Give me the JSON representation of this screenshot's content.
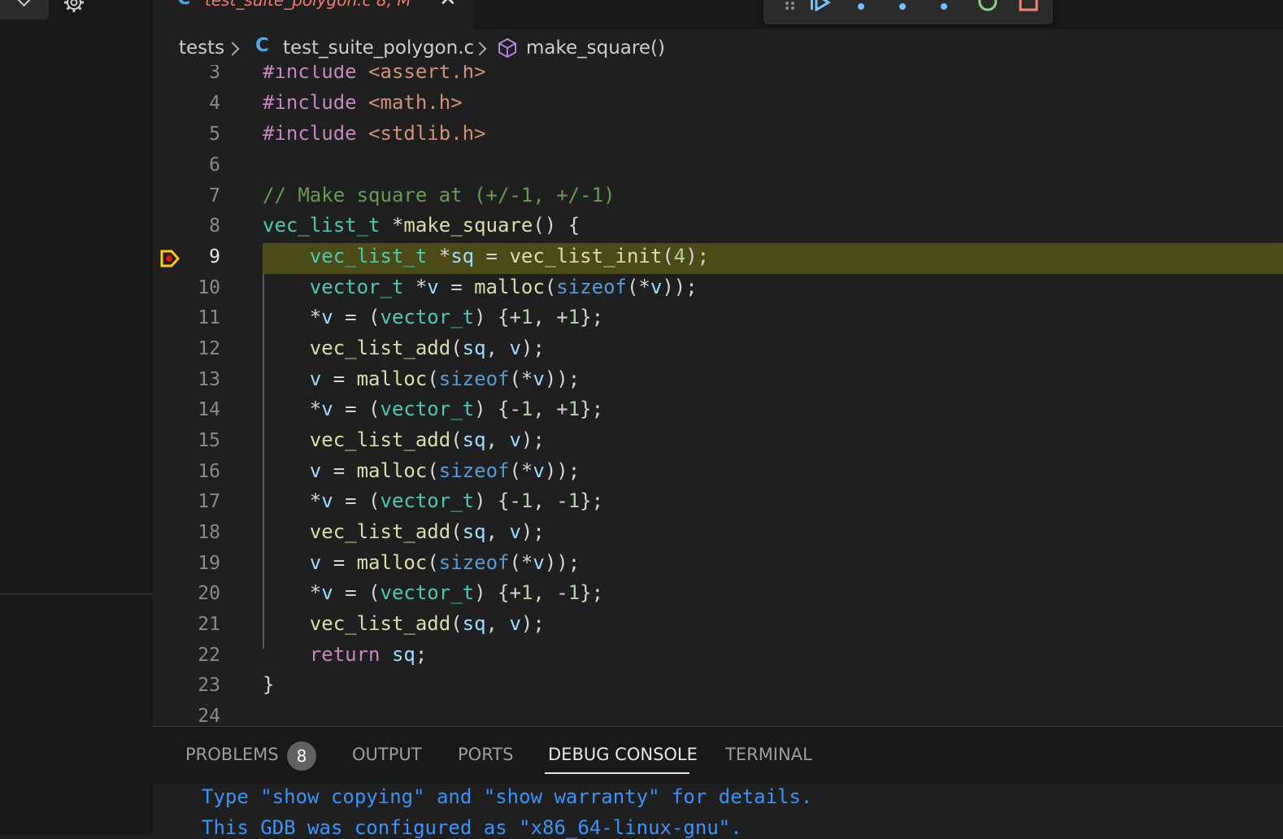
{
  "sidebar": {},
  "tab": {
    "icon_text": "C",
    "label": "test_suite_polygon.c 8, M"
  },
  "debug_toolbar": {
    "items": [
      "grip-icon",
      "continue-icon",
      "step-over-icon",
      "step-into-icon",
      "step-out-icon",
      "restart-icon",
      "stop-icon"
    ]
  },
  "breadcrumb": {
    "folder": "tests",
    "file_icon": "C",
    "file": "test_suite_polygon.c",
    "symbol": "make_square()"
  },
  "editor": {
    "current_line": 9,
    "lines": [
      {
        "n": "3"
      },
      {
        "n": "4"
      },
      {
        "n": "5"
      },
      {
        "n": "6"
      },
      {
        "n": "7"
      },
      {
        "n": "8"
      },
      {
        "n": "9"
      },
      {
        "n": "10"
      },
      {
        "n": "11"
      },
      {
        "n": "12"
      },
      {
        "n": "13"
      },
      {
        "n": "14"
      },
      {
        "n": "15"
      },
      {
        "n": "16"
      },
      {
        "n": "17"
      },
      {
        "n": "18"
      },
      {
        "n": "19"
      },
      {
        "n": "20"
      },
      {
        "n": "21"
      },
      {
        "n": "22"
      },
      {
        "n": "23"
      },
      {
        "n": "24"
      }
    ]
  },
  "panel": {
    "tabs": {
      "problems": "PROBLEMS",
      "problems_count": "8",
      "output": "OUTPUT",
      "ports": "PORTS",
      "debug_console": "DEBUG CONSOLE",
      "terminal": "TERMINAL"
    },
    "console_lines": [
      "Type \"show copying\" and \"show warranty\" for details.",
      "This GDB was configured as \"x86_64-linux-gnu\"."
    ]
  },
  "colors": {
    "current_line_highlight": "#4b4b18",
    "breakpoint_arrow": "#ffcc00",
    "breakpoint_dot": "#e51400",
    "console_text": "#3794ff",
    "tab_modified_label": "#f27a6d"
  }
}
